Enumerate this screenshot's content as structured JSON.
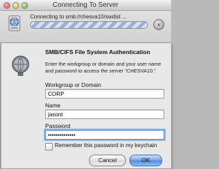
{
  "connecting_window": {
    "title": "Connecting To Server",
    "status": "Connecting to smb://chesva10/swdist ...",
    "stop_glyph": "×",
    "icon": "server-globe-icon"
  },
  "auth_sheet": {
    "icon": "network-globe-icon",
    "title": "SMB/CIFS File System Authentication",
    "description": "Enter the workgroup or domain and your user name and password to access the server \"CHESVA10.\"",
    "workgroup": {
      "label": "Workgroup or Domain",
      "value": "CORP"
    },
    "name": {
      "label": "Name",
      "value": "jasont"
    },
    "password": {
      "label": "Password",
      "value": "••••••••••••••"
    },
    "remember_label": "Remember this password in my keychain",
    "remember_checked": false,
    "cancel_label": "Cancel",
    "ok_label": "OK"
  }
}
